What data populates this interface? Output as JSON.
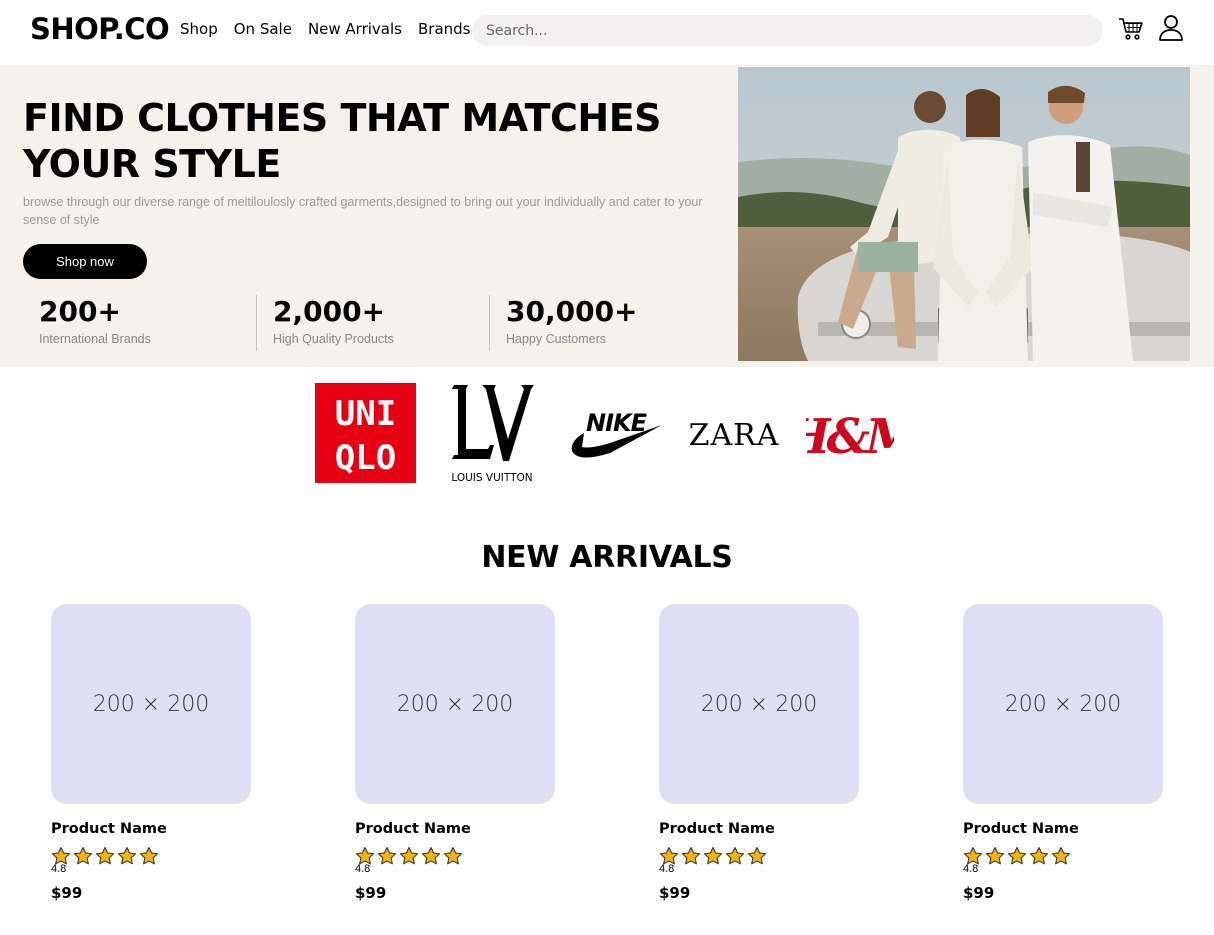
{
  "header": {
    "logo": "SHOP.CO",
    "nav": [
      "Shop",
      "On Sale",
      "New Arrivals",
      "Brands"
    ],
    "search_placeholder": "Search..."
  },
  "hero": {
    "title_line1": "FIND CLOTHES THAT MATCHES",
    "title_line2": "YOUR STYLE",
    "description": "browse through our diverse range of meltiloulosly crafted garments,designed to bring out your individually and cater to your sense of style",
    "cta": "Shop now",
    "stats": [
      {
        "value": "200+",
        "label": "International Brands"
      },
      {
        "value": "2,000+",
        "label": "High Quality Products"
      },
      {
        "value": "30,000+",
        "label": "Happy Customers"
      }
    ]
  },
  "brands": {
    "uniqlo_top": "UNI",
    "uniqlo_bottom": "QLO",
    "lv_caption": "LOUIS VUITTON",
    "zara": "ZARA",
    "hm": "H&M"
  },
  "new_arrivals": {
    "title": "NEW ARRIVALS",
    "products": [
      {
        "image_text": "200 × 200",
        "name": "Product Name",
        "rating": "4.8",
        "price": "$99"
      },
      {
        "image_text": "200 × 200",
        "name": "Product Name",
        "rating": "4.8",
        "price": "$99"
      },
      {
        "image_text": "200 × 200",
        "name": "Product Name",
        "rating": "4.8",
        "price": "$99"
      },
      {
        "image_text": "200 × 200",
        "name": "Product Name",
        "rating": "4.8",
        "price": "$99"
      }
    ]
  },
  "colors": {
    "hero_bg": "#f5f1eb",
    "thumb_bg": "#dedff3",
    "star": "#f5b60a",
    "uniqlo_red": "#e60012",
    "hm_red": "#cc071e"
  }
}
